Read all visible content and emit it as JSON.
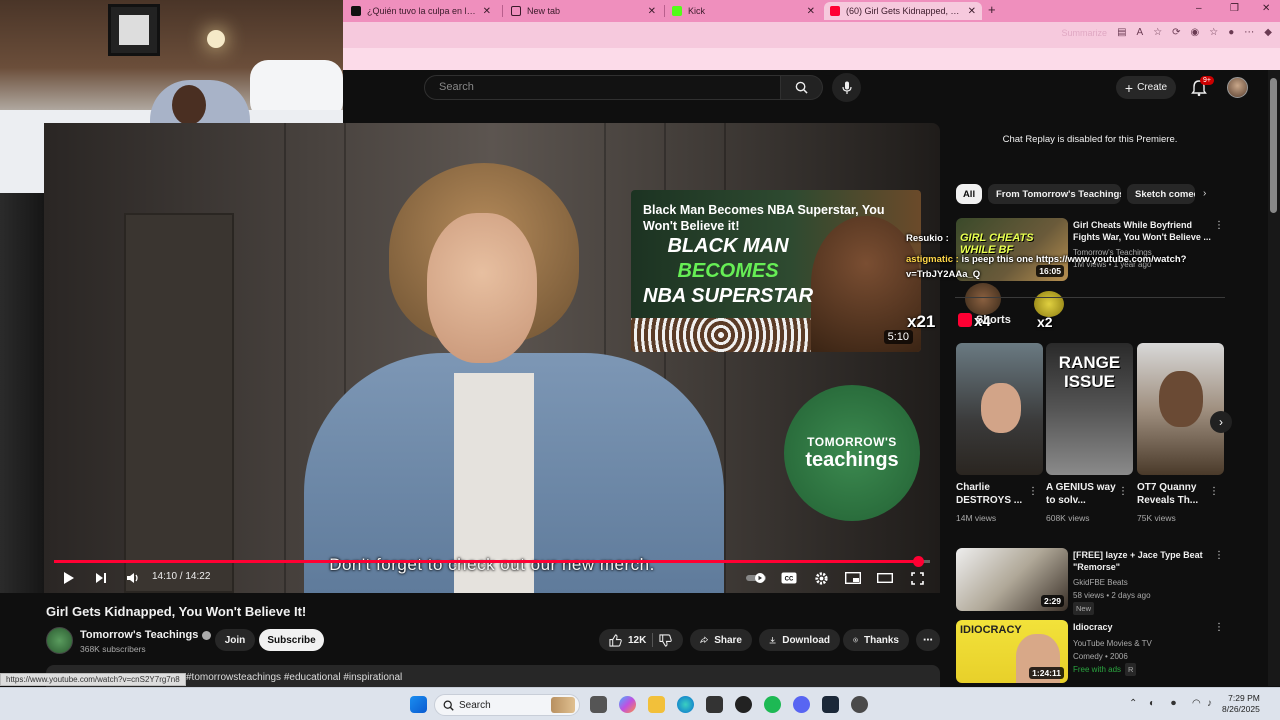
{
  "colors": {
    "tabbar": "#ef8fbd",
    "youtube_red": "#ff0033",
    "yt_background": "#0f0f0f",
    "chip_bg": "#272727",
    "logo_green": "#2a6d3c",
    "endcard_green_text": "#66ee55"
  },
  "browser": {
    "tabs": [
      {
        "title": "¿Quién tuvo la culpa en la historia?",
        "icon": "tiktok-icon",
        "active": false
      },
      {
        "title": "New tab",
        "icon": "new-tab-icon",
        "active": false
      },
      {
        "title": "Kick",
        "icon": "kick-icon",
        "active": false
      },
      {
        "title": "(60) Girl Gets Kidnapped, You Won't Believe It!",
        "icon": "youtube-icon",
        "active": true
      }
    ],
    "new_tab": "+",
    "window_controls": [
      "–",
      "❐",
      "✕"
    ],
    "addr_summarize": "Summarize",
    "status_url": "https://www.youtube.com/watch?v=cnS2Y7rg7n8"
  },
  "header": {
    "search_placeholder": "Search",
    "create_label": "Create",
    "notif_badge": "9+"
  },
  "player": {
    "endcard": {
      "title": "Black Man Becomes NBA Superstar, You Won't Believe it!",
      "big_line1": "BLACK MAN",
      "big_line2": "BECOMES",
      "big_line3": "NBA SUPERSTAR",
      "duration": "5:10"
    },
    "logo_line1": "TOMORROW'S",
    "logo_line2": "teachings",
    "caption": "Don't forget to check out our new merch.",
    "time": "14:10 / 14:22",
    "progress": 0.986
  },
  "video": {
    "title": "Girl Gets Kidnapped, You Won't Believe It!",
    "channel": "Tomorrow's Teachings",
    "subscribers": "368K subscribers",
    "join_label": "Join",
    "subscribe_label": "Subscribe",
    "likes": "12K",
    "share_label": "Share",
    "download_label": "Download",
    "thanks_label": "Thanks",
    "description_snippet": "#tomorrowsteachings #educational #inspirational"
  },
  "sidebar": {
    "chat_replay": "Chat Replay is disabled for this Premiere.",
    "chips": [
      "All",
      "From Tomorrow's Teachings",
      "Sketch comedy"
    ],
    "rec1": {
      "title": "Girl Cheats While Boyfriend Fights War, You Won't Believe ...",
      "channel": "Tomorrow's Teachings",
      "meta": "1M views • 1 year ago",
      "thumb_text": "GIRL CHEATS WHILE BF",
      "duration": "16:05"
    },
    "shorts_label": "Shorts",
    "shorts": [
      {
        "title": "Charlie DESTROYS ...",
        "views": "14M views"
      },
      {
        "title": "A GENIUS way to solv...",
        "views": "608K views",
        "thumb_text": "RANGE ISSUE"
      },
      {
        "title": "OT7 Quanny Reveals Th...",
        "views": "75K views"
      }
    ],
    "rec2": {
      "title": "[FREE] Iayze + Jace Type Beat \"Remorse\"",
      "channel": "GkidFBE Beats",
      "meta": "58 views • 2 days ago",
      "badge": "New",
      "duration": "2:29"
    },
    "rec3": {
      "title": "Idiocracy",
      "channel": "YouTube Movies & TV",
      "meta": "Comedy • 2006",
      "free": "Free with ads",
      "rating": "R",
      "thumb_text": "IDIOCRACY",
      "duration": "1:24:11"
    }
  },
  "chat_overlay": {
    "line1": "Resukio :",
    "line2_name": "astigmatic :",
    "line2_text": "is peep this one https://www.youtube.com/watch?v=TrbJY2AAa_Q",
    "emotes": [
      "x21",
      "x4",
      "x2"
    ]
  },
  "taskbar": {
    "search_label": "Search",
    "time": "7:29 PM",
    "date": "8/26/2025"
  }
}
